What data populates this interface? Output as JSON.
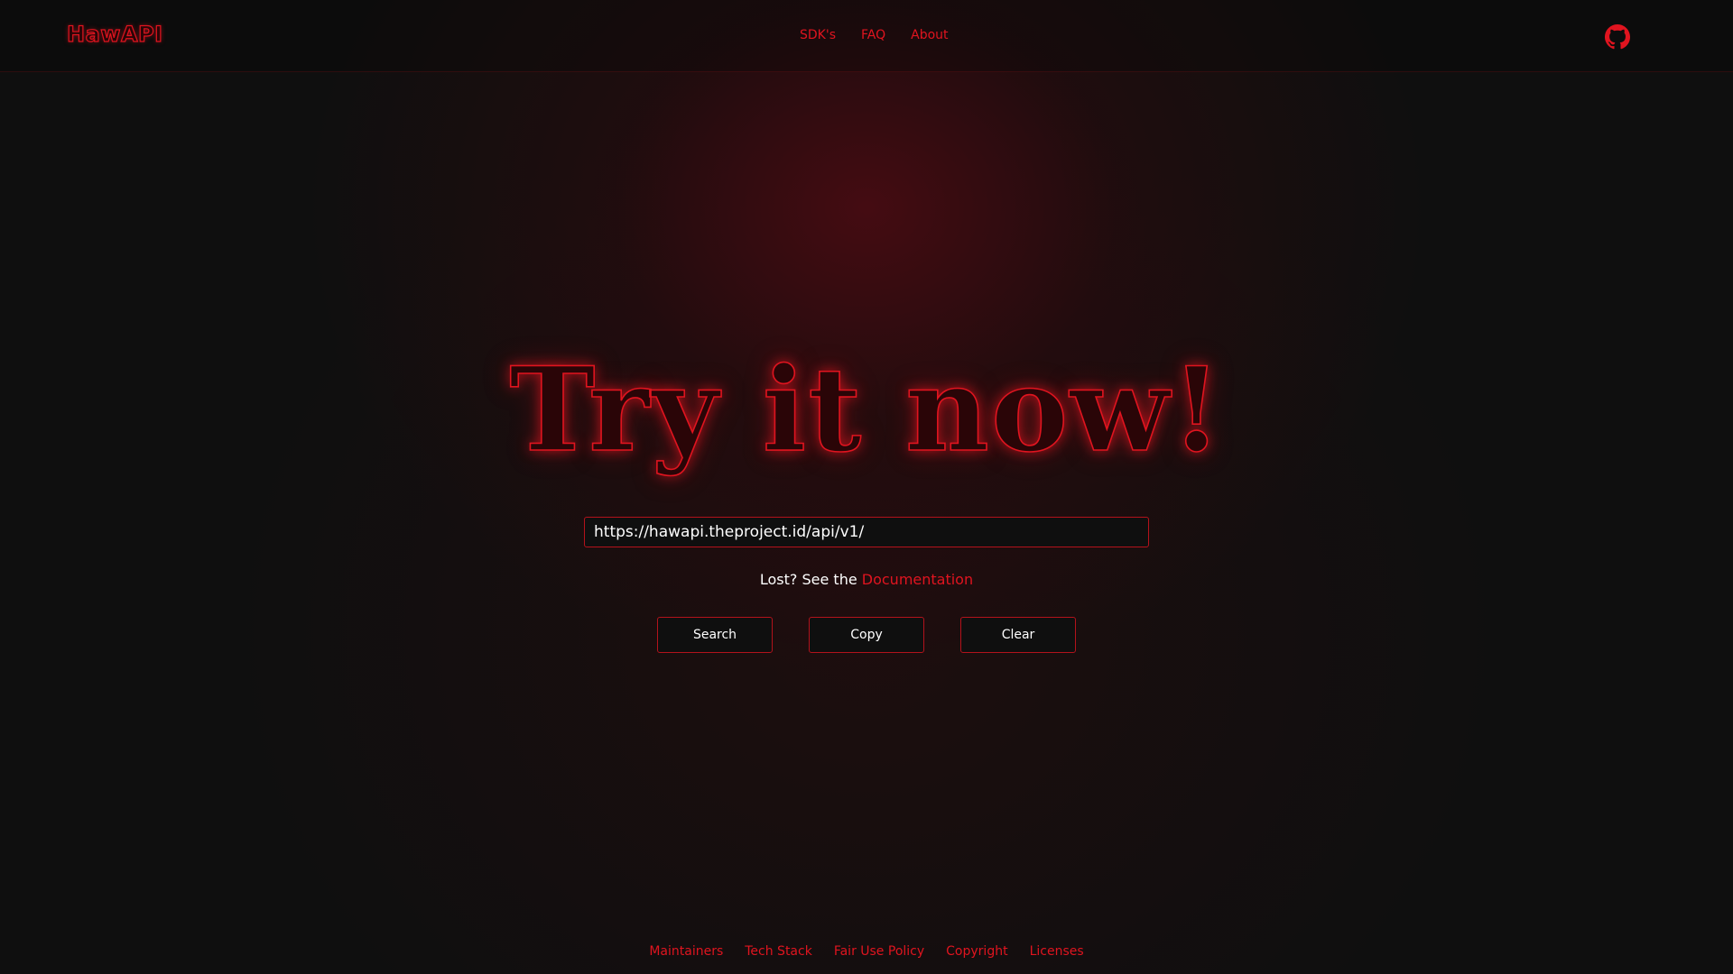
{
  "header": {
    "logo": "HawAPI",
    "nav": [
      {
        "label": "SDK's"
      },
      {
        "label": "FAQ"
      },
      {
        "label": "About"
      }
    ],
    "github_icon": "github-icon"
  },
  "hero": {
    "title": "Try it now!",
    "url_value": "https://hawapi.theproject.id/api/v1/",
    "hint_prefix": "Lost? See the ",
    "hint_link": "Documentation"
  },
  "buttons": {
    "search": "Search",
    "copy": "Copy",
    "clear": "Clear"
  },
  "footer": {
    "links": [
      {
        "label": "Maintainers"
      },
      {
        "label": "Tech Stack"
      },
      {
        "label": "Fair Use Policy"
      },
      {
        "label": "Copyright"
      },
      {
        "label": "Licenses"
      }
    ]
  },
  "colors": {
    "accent": "#e0141f",
    "background": "#0f0f0f",
    "border": "#b3121b"
  }
}
